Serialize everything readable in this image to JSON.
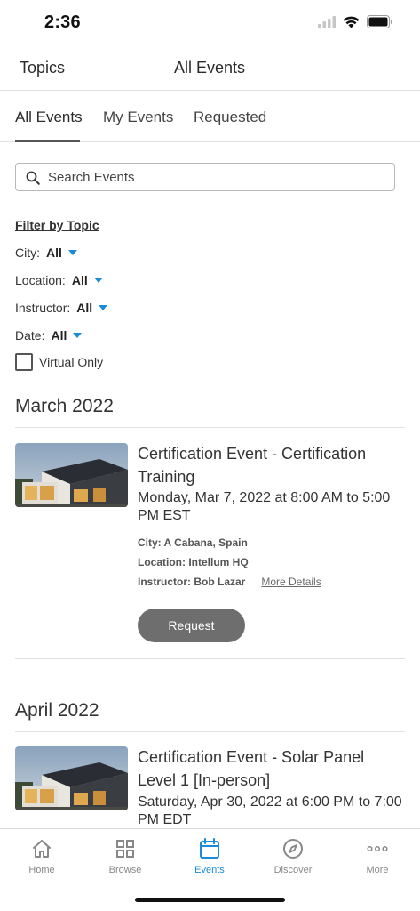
{
  "status": {
    "time": "2:36"
  },
  "header": {
    "topics_label": "Topics",
    "title": "All Events"
  },
  "tabs": [
    {
      "label": "All Events",
      "active": true
    },
    {
      "label": "My Events",
      "active": false
    },
    {
      "label": "Requested",
      "active": false
    }
  ],
  "search": {
    "placeholder": "Search Events",
    "value": ""
  },
  "filters": {
    "title": "Filter by Topic",
    "city": {
      "label": "City:",
      "value": "All"
    },
    "location": {
      "label": "Location:",
      "value": "All"
    },
    "instructor": {
      "label": "Instructor:",
      "value": "All"
    },
    "date": {
      "label": "Date:",
      "value": "All"
    },
    "virtual_only": {
      "label": "Virtual Only",
      "checked": false
    }
  },
  "months": [
    {
      "heading": "March 2022",
      "events": [
        {
          "title": "Certification Event - Certification Training",
          "date": "Monday, Mar 7, 2022 at 8:00 AM to 5:00 PM EST",
          "city": "City: A Cabana, Spain",
          "location": "Location: Intellum HQ",
          "instructor": "Instructor: Bob Lazar",
          "more_details": "More Details",
          "button": "Request"
        }
      ]
    },
    {
      "heading": "April 2022",
      "events": [
        {
          "title": "Certification Event - Solar Panel Level 1 [In-person]",
          "date": "Saturday, Apr 30, 2022 at 6:00 PM to 7:00 PM EDT"
        }
      ]
    }
  ],
  "bottom_nav": [
    {
      "label": "Home",
      "icon": "home-icon",
      "active": false
    },
    {
      "label": "Browse",
      "icon": "grid-icon",
      "active": false
    },
    {
      "label": "Events",
      "icon": "calendar-icon",
      "active": true
    },
    {
      "label": "Discover",
      "icon": "compass-icon",
      "active": false
    },
    {
      "label": "More",
      "icon": "more-icon",
      "active": false
    }
  ],
  "colors": {
    "accent": "#1a8bd8",
    "button": "#6e6e6e",
    "text": "#333333"
  }
}
